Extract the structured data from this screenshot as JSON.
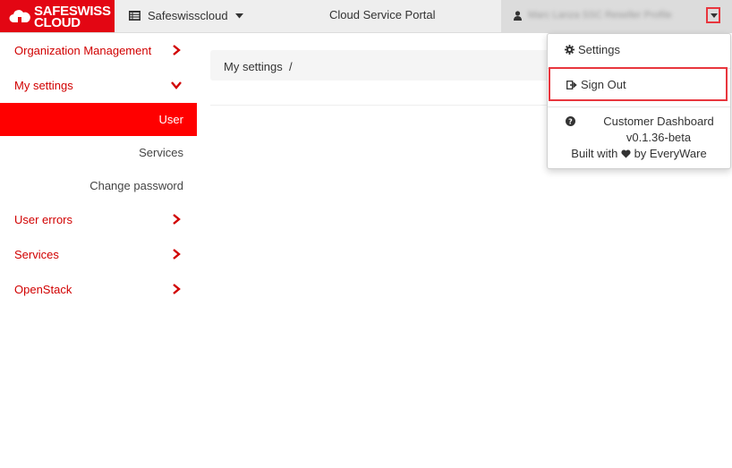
{
  "brand": {
    "line1_red": "SAFE",
    "line1_white": "SWISS",
    "line2": "CLOUD"
  },
  "header": {
    "org_name": "Safeswisscloud",
    "portal_title": "Cloud Service Portal",
    "user_name": "Marc Lanza SSC Reseller Profile"
  },
  "sidebar": {
    "items": [
      {
        "label": "Organization Management"
      },
      {
        "label": "My settings"
      },
      {
        "label": "User errors"
      },
      {
        "label": "Services"
      },
      {
        "label": "OpenStack"
      }
    ],
    "sub_items": [
      {
        "label": "User"
      },
      {
        "label": "Services"
      },
      {
        "label": "Change password"
      }
    ]
  },
  "main": {
    "breadcrumb": "My settings  /"
  },
  "dropdown": {
    "settings_label": "Settings",
    "signout_label": "Sign Out",
    "info_title": "Customer Dashboard",
    "version": "v0.1.36-beta",
    "built_with_prefix": "Built with",
    "built_with_suffix": "by EveryWare"
  },
  "colors": {
    "brand_red": "#e30613",
    "nav_red": "#d10000",
    "active_bg": "#ff0000",
    "highlight": "#e8363e"
  }
}
